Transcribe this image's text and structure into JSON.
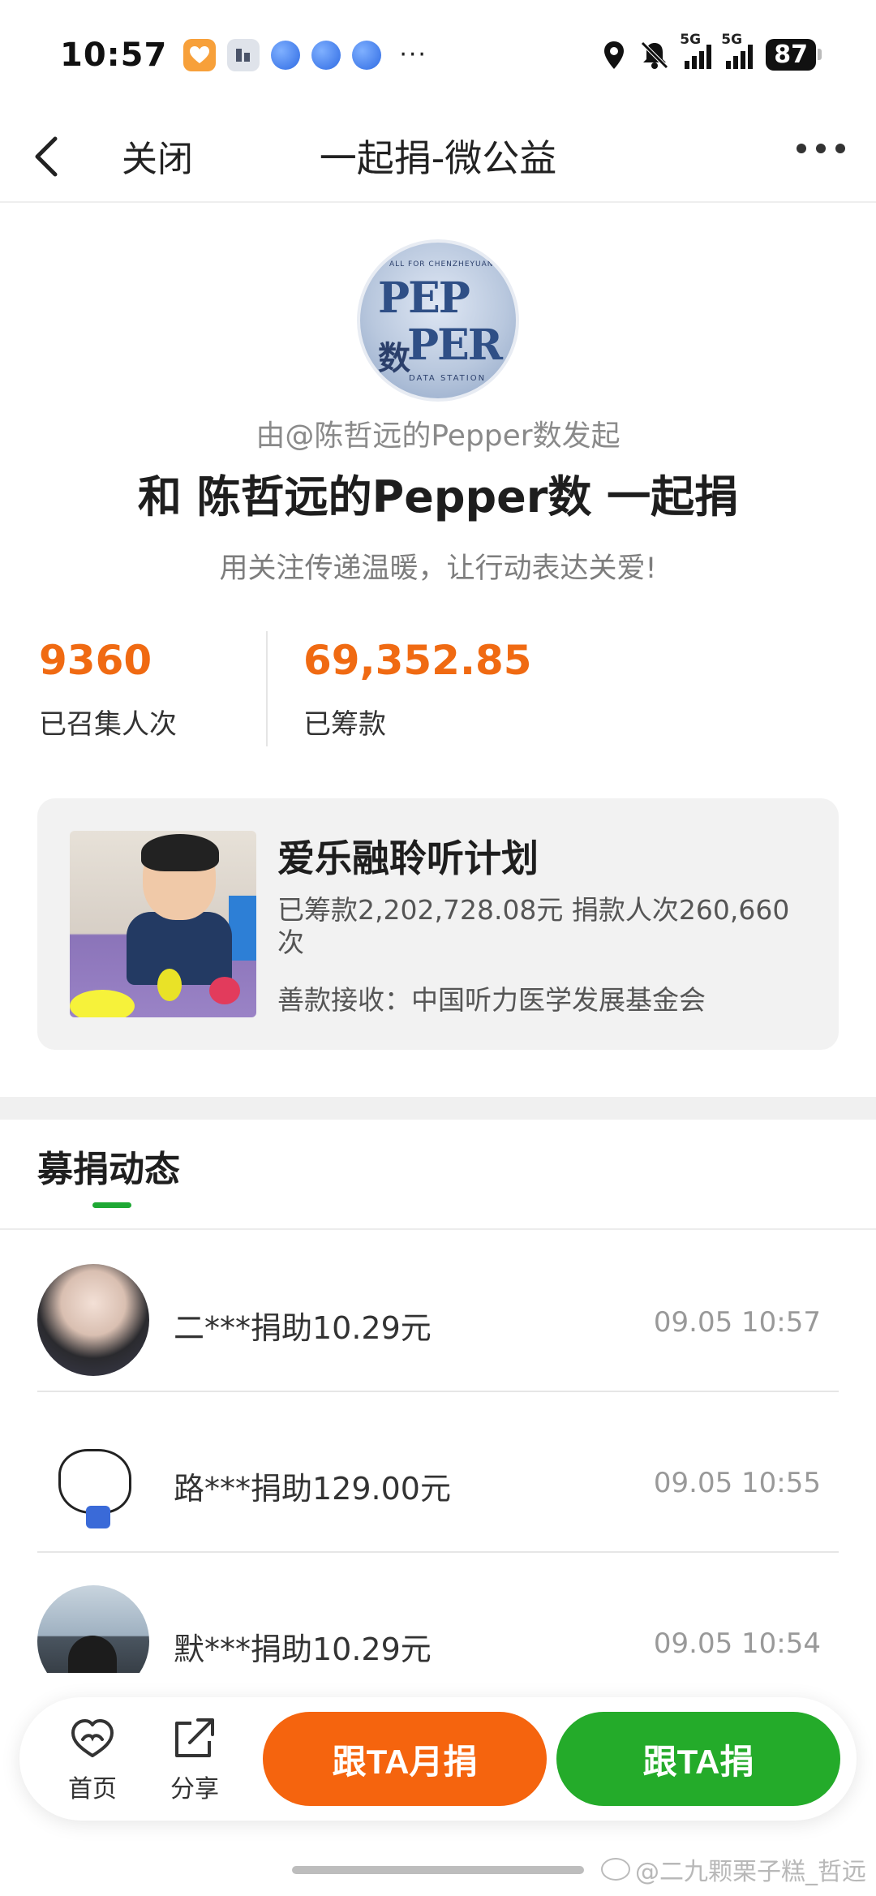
{
  "status_bar": {
    "time": "10:57",
    "dots": "···",
    "sig1_label": "5G",
    "sig2_label": "5G",
    "battery": "87"
  },
  "nav": {
    "close_label": "关闭",
    "title": "一起捐-微公益"
  },
  "header": {
    "initiator": "由@陈哲远的Pepper数发起",
    "headline": "和 陈哲远的Pepper数 一起捐",
    "slogan": "用关注传递温暖，让行动表达关爱!",
    "logo_text": {
      "line1": "PEP",
      "line2": "PER",
      "cn": "数",
      "caption": "DATA STATION",
      "top": "ALL FOR CHENZHEYUAN"
    }
  },
  "stats": {
    "participants_value": "9360",
    "participants_label": "已召集人次",
    "raised_value": "69,352.85",
    "raised_label": "已筹款"
  },
  "project": {
    "title": "爱乐融聆听计划",
    "stats_line": "已筹款2,202,728.08元  捐款人次260,660次",
    "recipient": "善款接收：中国听力医学发展基金会"
  },
  "feed": {
    "tab_label": "募捐动态",
    "items": [
      {
        "text": "二***捐助10.29元",
        "time": "09.05 10:57"
      },
      {
        "text": "路***捐助129.00元",
        "time": "09.05 10:55"
      },
      {
        "text": "默***捐助10.29元",
        "time": "09.05 10:54"
      }
    ]
  },
  "bottom_bar": {
    "home_label": "首页",
    "share_label": "分享",
    "monthly_button": "跟TA月捐",
    "donate_button": "跟TA捐"
  },
  "watermark": "@二九颗栗子糕_哲远",
  "colors": {
    "accent_orange": "#f5640e",
    "accent_green": "#24ab2a",
    "stat_orange": "#f06a12"
  }
}
